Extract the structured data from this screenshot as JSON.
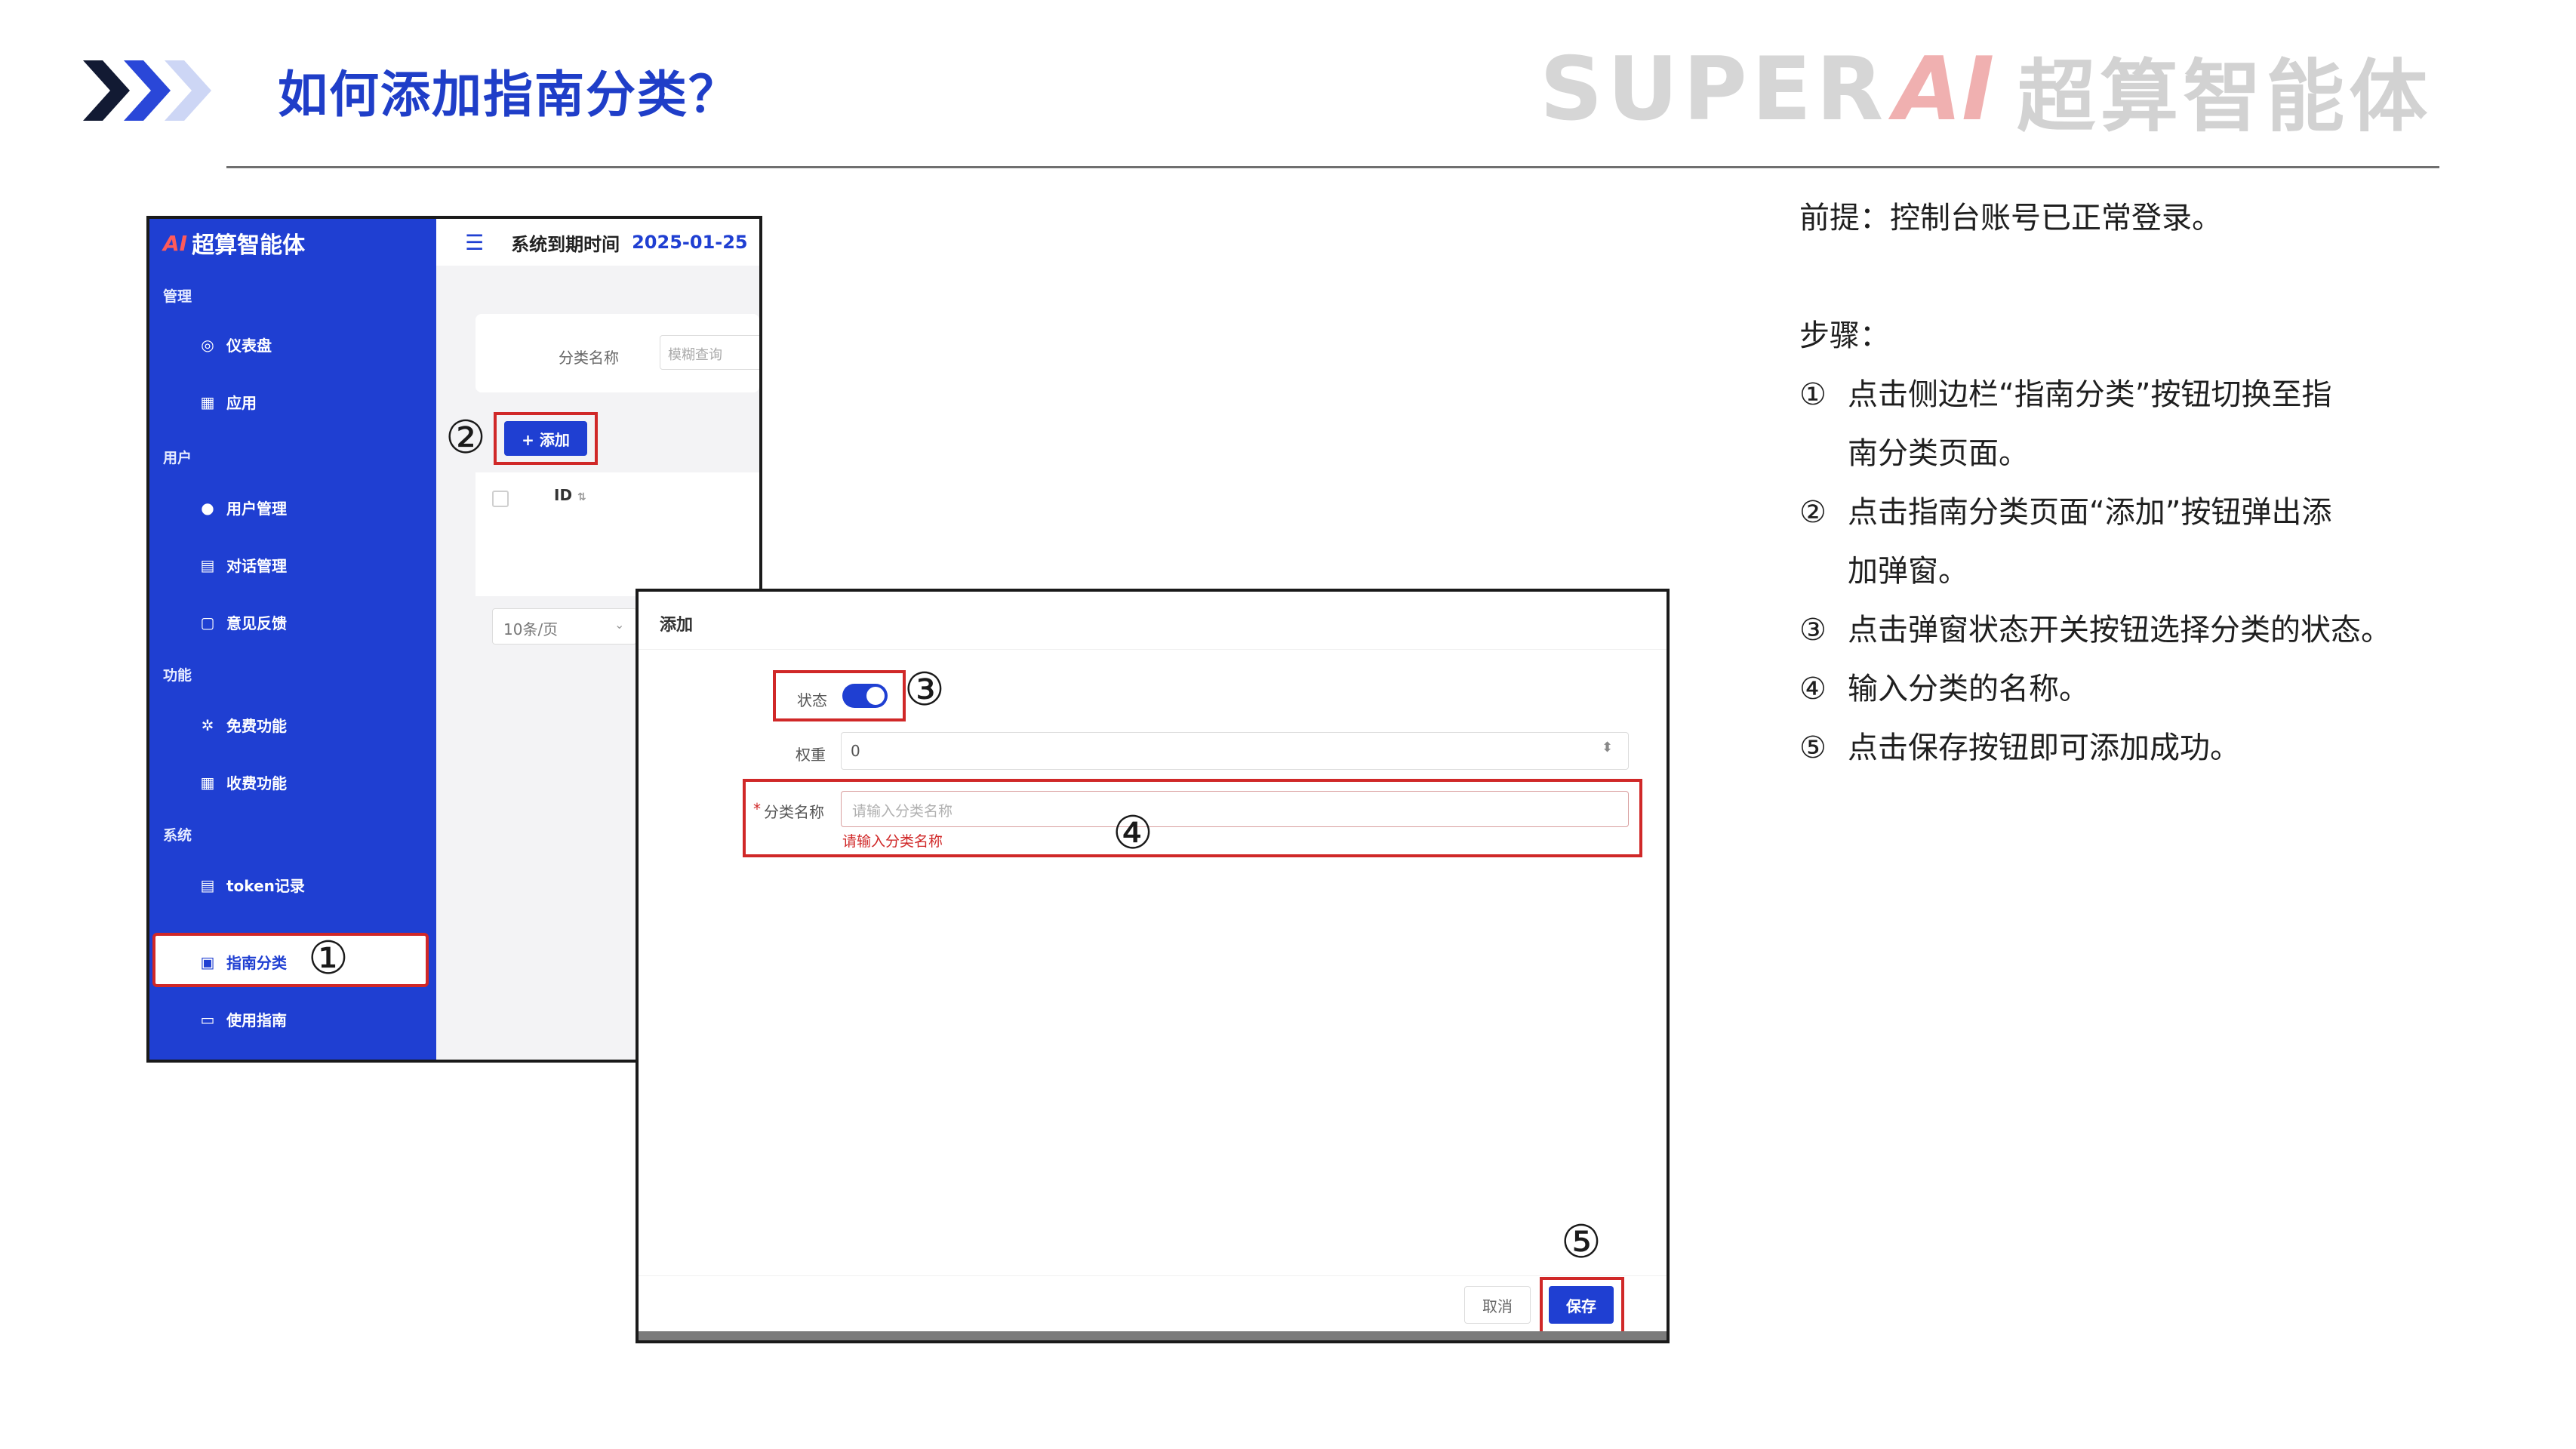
{
  "header": {
    "title": "如何添加指南分类？",
    "brand_latin": "SUPER",
    "brand_ai": "AI",
    "brand_cn": "超算智能体",
    "accent_color": "#1f3ec8"
  },
  "instructions": {
    "premise": "前提：控制台账号已正常登录。",
    "steps_title": "步骤：",
    "steps": [
      {
        "num": "①",
        "line1": "点击侧边栏“指南分类”按钮切换至指",
        "line2": "南分类页面。"
      },
      {
        "num": "②",
        "line1": "点击指南分类页面“添加”按钮弹出添",
        "line2": "加弹窗。"
      },
      {
        "num": "③",
        "line1": "点击弹窗状态开关按钮选择分类的状态。"
      },
      {
        "num": "④",
        "line1": "输入分类的名称。"
      },
      {
        "num": "⑤",
        "line1": "点击保存按钮即可添加成功。"
      }
    ]
  },
  "console": {
    "logo_mark": "AI",
    "logo_text": "超算智能体",
    "topbar": {
      "expire_label": "系统到期时间",
      "expire_date": "2025-01-25"
    },
    "groups": [
      "管理",
      "用户",
      "功能",
      "系统"
    ],
    "items": [
      {
        "label": "仪表盘",
        "icon": "dashboard-icon"
      },
      {
        "label": "应用",
        "icon": "apps-grid-icon"
      },
      {
        "label": "用户管理",
        "icon": "user-icon"
      },
      {
        "label": "对话管理",
        "icon": "chat-log-icon"
      },
      {
        "label": "意见反馈",
        "icon": "feedback-icon"
      },
      {
        "label": "免费功能",
        "icon": "gear-icon"
      },
      {
        "label": "收费功能",
        "icon": "apps-grid-icon"
      },
      {
        "label": "token记录",
        "icon": "record-icon"
      },
      {
        "label": "指南分类",
        "icon": "guide-category-icon"
      },
      {
        "label": "使用指南",
        "icon": "guide-icon"
      }
    ],
    "filter": {
      "label": "分类名称",
      "placeholder": "模糊查询"
    },
    "add_button": "+ 添加",
    "table": {
      "id_header": "ID"
    },
    "pager": "10条/页"
  },
  "modal": {
    "title": "添加",
    "status_label": "状态",
    "status_on": true,
    "weight_label": "权重",
    "weight_value": "0",
    "name_required_mark": "*",
    "name_label": "分类名称",
    "name_placeholder": "请输入分类名称",
    "name_error": "请输入分类名称",
    "cancel": "取消",
    "save": "保存"
  },
  "markers": [
    "①",
    "②",
    "③",
    "④",
    "⑤"
  ],
  "colors": {
    "primary": "#1f3fd2",
    "highlight": "#d02828"
  }
}
